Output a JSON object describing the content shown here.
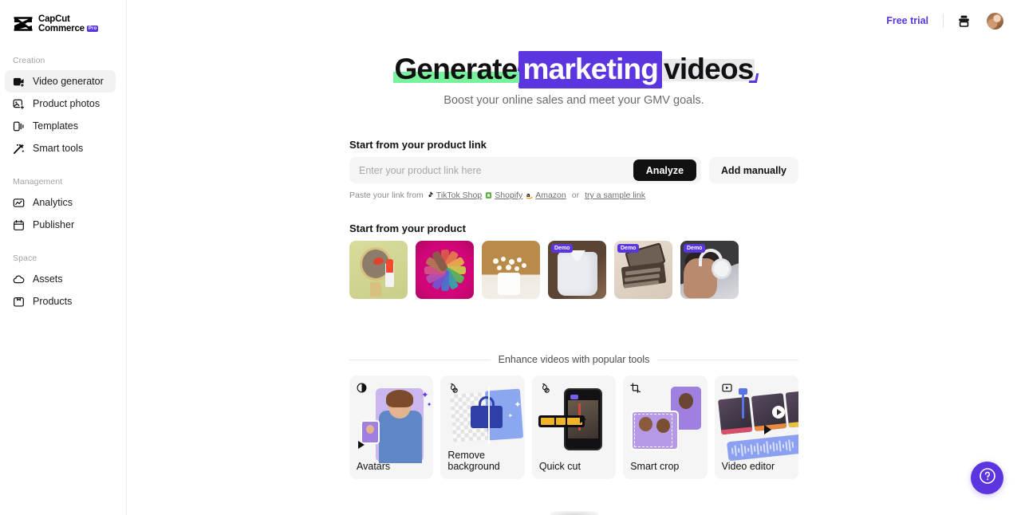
{
  "brand": {
    "name_line1": "CapCut",
    "name_line2": "Commerce",
    "badge": "Pro",
    "accent": "#5a35e0"
  },
  "sidebar": {
    "groups": [
      {
        "label": "Creation",
        "items": [
          {
            "label": "Video generator",
            "icon": "video-generator-icon",
            "active": true
          },
          {
            "label": "Product photos",
            "icon": "product-photos-icon",
            "active": false
          },
          {
            "label": "Templates",
            "icon": "templates-icon",
            "active": false
          },
          {
            "label": "Smart tools",
            "icon": "smart-tools-icon",
            "active": false
          }
        ]
      },
      {
        "label": "Management",
        "items": [
          {
            "label": "Analytics",
            "icon": "analytics-icon",
            "active": false
          },
          {
            "label": "Publisher",
            "icon": "publisher-icon",
            "active": false
          }
        ]
      },
      {
        "label": "Space",
        "items": [
          {
            "label": "Assets",
            "icon": "assets-icon",
            "active": false
          },
          {
            "label": "Products",
            "icon": "products-icon",
            "active": false
          }
        ]
      }
    ]
  },
  "topbar": {
    "free_trial": "Free trial",
    "export_icon": "export-icon",
    "avatar": "user-avatar"
  },
  "hero": {
    "word1": "Generate",
    "word2": "marketing",
    "word3": "videos",
    "subtitle": "Boost your online sales and meet your GMV goals.",
    "highlight_green": "#79f29e",
    "highlight_purple": "#5a35e0",
    "highlight_grey": "#e9e9ed"
  },
  "link_section": {
    "title": "Start from your product link",
    "placeholder": "Enter your product link here",
    "value": "",
    "analyze_label": "Analyze",
    "manual_label": "Add manually",
    "paste_prefix": "Paste your link from",
    "sources": [
      {
        "label": "TikTok Shop",
        "icon": "tiktok-icon"
      },
      {
        "label": "Shopify",
        "icon": "shopify-icon"
      },
      {
        "label": "Amazon",
        "icon": "amazon-icon"
      }
    ],
    "or": "or",
    "sample_link": "try a sample link"
  },
  "product_section": {
    "title": "Start from your product",
    "demo_badge": "Demo",
    "items": [
      {
        "name": "lipstick-mirror",
        "demo": false
      },
      {
        "name": "lipstick-wheel",
        "demo": false
      },
      {
        "name": "flower-vase",
        "demo": false
      },
      {
        "name": "white-shirt",
        "demo": true
      },
      {
        "name": "eyeshadow-palette",
        "demo": true
      },
      {
        "name": "headphones-man",
        "demo": true
      }
    ]
  },
  "tools_section": {
    "divider_title": "Enhance videos with popular tools",
    "cards": [
      {
        "label": "Avatars",
        "icon": "avatar-contrast-icon",
        "art": "avatars"
      },
      {
        "label": "Remove background",
        "icon": "remove-background-icon",
        "art": "removebg"
      },
      {
        "label": "Quick cut",
        "icon": "quick-cut-icon",
        "art": "quickcut"
      },
      {
        "label": "Smart crop",
        "icon": "smart-crop-icon",
        "art": "smartcrop"
      },
      {
        "label": "Video editor",
        "icon": "video-editor-icon",
        "art": "videoeditor"
      }
    ]
  },
  "help": {
    "icon": "help-question-icon",
    "color": "#5a35e0"
  }
}
